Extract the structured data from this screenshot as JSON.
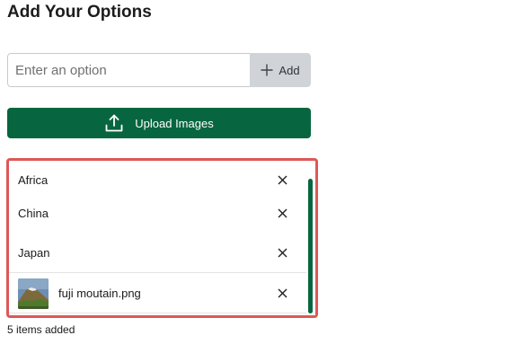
{
  "header": {
    "title": "Add Your Options"
  },
  "input": {
    "value": "",
    "placeholder": "Enter an option"
  },
  "add_button": {
    "label": "Add"
  },
  "upload_button": {
    "label": "Upload Images"
  },
  "items": [
    {
      "label": "Africa",
      "type": "text"
    },
    {
      "label": "China",
      "type": "text"
    },
    {
      "label": "Japan",
      "type": "text"
    },
    {
      "label": "fuji moutain.png",
      "type": "image"
    }
  ],
  "status": {
    "count_text": "5 items added"
  },
  "colors": {
    "accent": "#07663f",
    "highlight_border": "#de5757",
    "add_button_bg": "#d0d3d8"
  },
  "icons": {
    "add": "plus-icon",
    "upload": "upload-icon",
    "remove": "close-icon",
    "thumbnail": "image-thumbnail"
  }
}
